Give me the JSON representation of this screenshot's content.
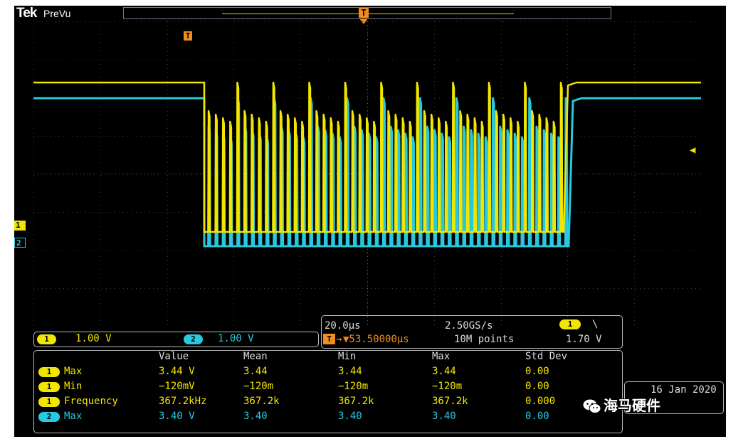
{
  "header": {
    "brand": "Tek",
    "mode": "PreVu",
    "trigger_glyph": "T"
  },
  "channels": [
    {
      "id": "1",
      "color": "#f2e600"
    },
    {
      "id": "2",
      "color": "#28c8e0"
    }
  ],
  "scales": {
    "ch1": {
      "label": "1",
      "value": "1.00 V"
    },
    "ch2": {
      "label": "2",
      "value": "1.00 V"
    }
  },
  "horizontal": {
    "time_div": "20.0µs",
    "sample_rate": "2.50GS/s",
    "trigger_position": "▼53.50000µs",
    "trigger_prefix_glyph": "T→",
    "record_length": "10M points",
    "trigger_source": "1",
    "trigger_slope": "\\",
    "trigger_level": "1.70 V"
  },
  "measurements": {
    "columns": [
      "Value",
      "Mean",
      "Min",
      "Max",
      "Std Dev"
    ],
    "rows": [
      {
        "channel": "1",
        "name": "Max",
        "value": "3.44 V",
        "mean": "3.44",
        "min": "3.44",
        "max": "3.44",
        "std": "0.00"
      },
      {
        "channel": "1",
        "name": "Min",
        "value": "−120mV",
        "mean": "−120m",
        "min": "−120m",
        "max": "−120m",
        "std": "0.00"
      },
      {
        "channel": "1",
        "name": "Frequency",
        "value": "367.2kHz",
        "mean": "367.2k",
        "min": "367.2k",
        "max": "367.2k",
        "std": "0.000"
      },
      {
        "channel": "2",
        "name": "Max",
        "value": "3.40 V",
        "mean": "3.40",
        "min": "3.40",
        "max": "3.40",
        "std": "0.00"
      }
    ]
  },
  "date": "16 Jan  2020",
  "watermark": "海马硬件",
  "icons": {
    "wechat": "wechat-icon",
    "trigger": "trigger-marker-icon",
    "level": "trigger-level-arrow-icon"
  }
}
